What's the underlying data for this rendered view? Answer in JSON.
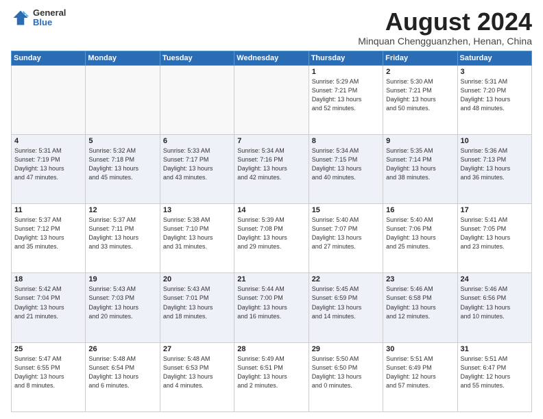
{
  "logo": {
    "general": "General",
    "blue": "Blue"
  },
  "title": "August 2024",
  "location": "Minquan Chengguanzhen, Henan, China",
  "days_header": [
    "Sunday",
    "Monday",
    "Tuesday",
    "Wednesday",
    "Thursday",
    "Friday",
    "Saturday"
  ],
  "weeks": [
    [
      {
        "day": "",
        "text": ""
      },
      {
        "day": "",
        "text": ""
      },
      {
        "day": "",
        "text": ""
      },
      {
        "day": "",
        "text": ""
      },
      {
        "day": "1",
        "text": "Sunrise: 5:29 AM\nSunset: 7:21 PM\nDaylight: 13 hours\nand 52 minutes."
      },
      {
        "day": "2",
        "text": "Sunrise: 5:30 AM\nSunset: 7:21 PM\nDaylight: 13 hours\nand 50 minutes."
      },
      {
        "day": "3",
        "text": "Sunrise: 5:31 AM\nSunset: 7:20 PM\nDaylight: 13 hours\nand 48 minutes."
      }
    ],
    [
      {
        "day": "4",
        "text": "Sunrise: 5:31 AM\nSunset: 7:19 PM\nDaylight: 13 hours\nand 47 minutes."
      },
      {
        "day": "5",
        "text": "Sunrise: 5:32 AM\nSunset: 7:18 PM\nDaylight: 13 hours\nand 45 minutes."
      },
      {
        "day": "6",
        "text": "Sunrise: 5:33 AM\nSunset: 7:17 PM\nDaylight: 13 hours\nand 43 minutes."
      },
      {
        "day": "7",
        "text": "Sunrise: 5:34 AM\nSunset: 7:16 PM\nDaylight: 13 hours\nand 42 minutes."
      },
      {
        "day": "8",
        "text": "Sunrise: 5:34 AM\nSunset: 7:15 PM\nDaylight: 13 hours\nand 40 minutes."
      },
      {
        "day": "9",
        "text": "Sunrise: 5:35 AM\nSunset: 7:14 PM\nDaylight: 13 hours\nand 38 minutes."
      },
      {
        "day": "10",
        "text": "Sunrise: 5:36 AM\nSunset: 7:13 PM\nDaylight: 13 hours\nand 36 minutes."
      }
    ],
    [
      {
        "day": "11",
        "text": "Sunrise: 5:37 AM\nSunset: 7:12 PM\nDaylight: 13 hours\nand 35 minutes."
      },
      {
        "day": "12",
        "text": "Sunrise: 5:37 AM\nSunset: 7:11 PM\nDaylight: 13 hours\nand 33 minutes."
      },
      {
        "day": "13",
        "text": "Sunrise: 5:38 AM\nSunset: 7:10 PM\nDaylight: 13 hours\nand 31 minutes."
      },
      {
        "day": "14",
        "text": "Sunrise: 5:39 AM\nSunset: 7:08 PM\nDaylight: 13 hours\nand 29 minutes."
      },
      {
        "day": "15",
        "text": "Sunrise: 5:40 AM\nSunset: 7:07 PM\nDaylight: 13 hours\nand 27 minutes."
      },
      {
        "day": "16",
        "text": "Sunrise: 5:40 AM\nSunset: 7:06 PM\nDaylight: 13 hours\nand 25 minutes."
      },
      {
        "day": "17",
        "text": "Sunrise: 5:41 AM\nSunset: 7:05 PM\nDaylight: 13 hours\nand 23 minutes."
      }
    ],
    [
      {
        "day": "18",
        "text": "Sunrise: 5:42 AM\nSunset: 7:04 PM\nDaylight: 13 hours\nand 21 minutes."
      },
      {
        "day": "19",
        "text": "Sunrise: 5:43 AM\nSunset: 7:03 PM\nDaylight: 13 hours\nand 20 minutes."
      },
      {
        "day": "20",
        "text": "Sunrise: 5:43 AM\nSunset: 7:01 PM\nDaylight: 13 hours\nand 18 minutes."
      },
      {
        "day": "21",
        "text": "Sunrise: 5:44 AM\nSunset: 7:00 PM\nDaylight: 13 hours\nand 16 minutes."
      },
      {
        "day": "22",
        "text": "Sunrise: 5:45 AM\nSunset: 6:59 PM\nDaylight: 13 hours\nand 14 minutes."
      },
      {
        "day": "23",
        "text": "Sunrise: 5:46 AM\nSunset: 6:58 PM\nDaylight: 13 hours\nand 12 minutes."
      },
      {
        "day": "24",
        "text": "Sunrise: 5:46 AM\nSunset: 6:56 PM\nDaylight: 13 hours\nand 10 minutes."
      }
    ],
    [
      {
        "day": "25",
        "text": "Sunrise: 5:47 AM\nSunset: 6:55 PM\nDaylight: 13 hours\nand 8 minutes."
      },
      {
        "day": "26",
        "text": "Sunrise: 5:48 AM\nSunset: 6:54 PM\nDaylight: 13 hours\nand 6 minutes."
      },
      {
        "day": "27",
        "text": "Sunrise: 5:48 AM\nSunset: 6:53 PM\nDaylight: 13 hours\nand 4 minutes."
      },
      {
        "day": "28",
        "text": "Sunrise: 5:49 AM\nSunset: 6:51 PM\nDaylight: 13 hours\nand 2 minutes."
      },
      {
        "day": "29",
        "text": "Sunrise: 5:50 AM\nSunset: 6:50 PM\nDaylight: 13 hours\nand 0 minutes."
      },
      {
        "day": "30",
        "text": "Sunrise: 5:51 AM\nSunset: 6:49 PM\nDaylight: 12 hours\nand 57 minutes."
      },
      {
        "day": "31",
        "text": "Sunrise: 5:51 AM\nSunset: 6:47 PM\nDaylight: 12 hours\nand 55 minutes."
      }
    ]
  ]
}
